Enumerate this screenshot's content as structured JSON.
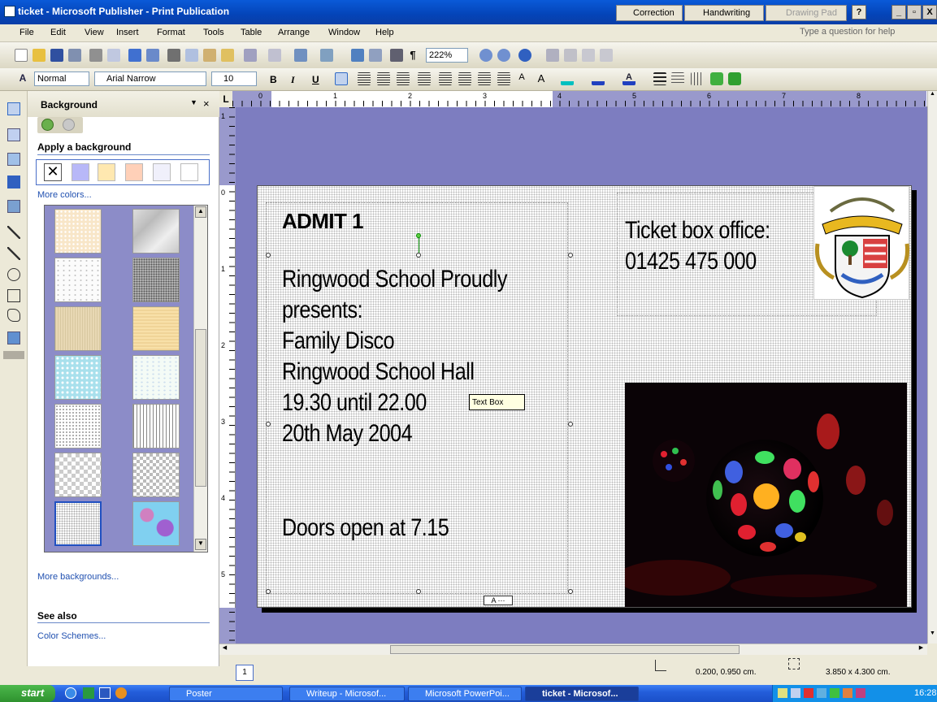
{
  "window": {
    "title": "ticket - Microsoft Publisher - Print Publication"
  },
  "titlebar_buttons": {
    "correction": "Correction",
    "handwriting": "Handwriting",
    "drawing_pad": "Drawing Pad",
    "help": "?",
    "minimize": "_",
    "restore": "▫",
    "close": "X"
  },
  "menu": {
    "items": [
      "File",
      "Edit",
      "View",
      "Insert",
      "Format",
      "Tools",
      "Table",
      "Arrange",
      "Window",
      "Help"
    ],
    "help_placeholder": "Type a question for help"
  },
  "toolbar": {
    "zoom": "222%"
  },
  "format_toolbar": {
    "style": "Normal",
    "font": "Arial Narrow",
    "size": "10",
    "bold": "B",
    "italic": "I",
    "underline": "U"
  },
  "task_pane": {
    "title": "Background",
    "apply_heading": "Apply a background",
    "more_colors": "More colors...",
    "more_backgrounds": "More backgrounds...",
    "see_also": "See also",
    "color_schemes": "Color Schemes...",
    "swatches": [
      "#b8b8f8",
      "#ffe8b0",
      "#ffd0b8",
      "#f0f0fb",
      "#ffffff"
    ]
  },
  "ruler": {
    "h_labels": [
      "0",
      "1",
      "2",
      "3",
      "4",
      "5",
      "6",
      "7",
      "8"
    ],
    "v_labels": [
      "1",
      "0",
      "1",
      "2",
      "3",
      "4",
      "5"
    ],
    "corner": "L"
  },
  "ticket": {
    "admit": "ADMIT 1",
    "line1": "Ringwood School Proudly",
    "line2": "presents:",
    "line3": "Family Disco",
    "line4": "Ringwood School Hall",
    "line5": "19.30 until 22.00",
    "line6": "20th May 2004",
    "line7": "Doors open at 7.15",
    "box_office_1": "Ticket box office:",
    "box_office_2": "01425 475 000",
    "tooltip": "Text Box",
    "overflow_tag": "A ⋯"
  },
  "status": {
    "page": "1",
    "position": "0.200, 0.950 cm.",
    "size": "3.850 x 4.300 cm."
  },
  "taskbar": {
    "start": "start",
    "items": [
      "Poster",
      "Writeup - Microsof...",
      "Microsoft PowerPoi...",
      "ticket - Microsof..."
    ],
    "clock": "16:28"
  }
}
